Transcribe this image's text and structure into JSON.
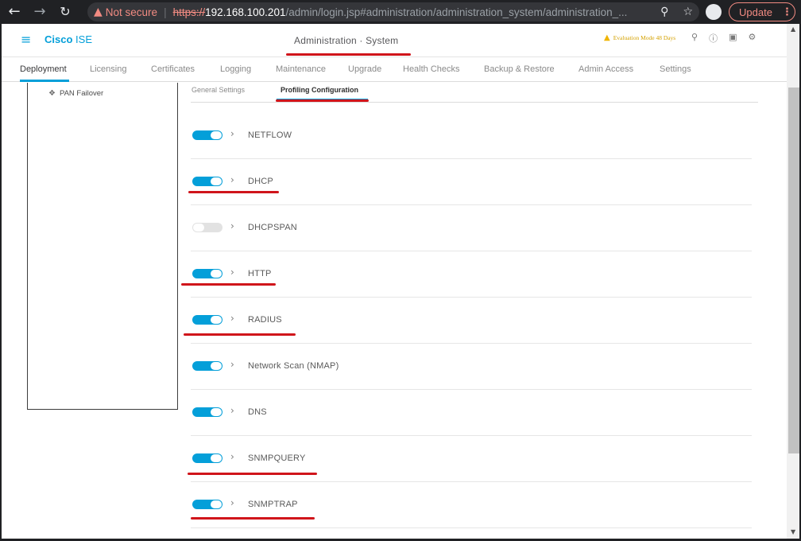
{
  "browser": {
    "not_secure": "Not secure",
    "url_scheme": "https://",
    "url_host": "192.168.100.201",
    "url_path": "/admin/login.jsp#administration/administration_system/administration_...",
    "update_label": "Update"
  },
  "header": {
    "brand_cisco": "Cisco",
    "brand_product": "ISE",
    "page_title": "Administration · System",
    "evaluation": "Evaluation Mode 48 Days"
  },
  "tabs": [
    "Deployment",
    "Licensing",
    "Certificates",
    "Logging",
    "Maintenance",
    "Upgrade",
    "Health Checks",
    "Backup & Restore",
    "Admin Access",
    "Settings"
  ],
  "tree": {
    "item": "PAN Failover"
  },
  "subtabs": {
    "general": "General Settings",
    "profiling": "Profiling Configuration"
  },
  "probes": [
    {
      "label": "NETFLOW",
      "enabled": true
    },
    {
      "label": "DHCP",
      "enabled": true
    },
    {
      "label": "DHCPSPAN",
      "enabled": false
    },
    {
      "label": "HTTP",
      "enabled": true
    },
    {
      "label": "RADIUS",
      "enabled": true
    },
    {
      "label": "Network Scan (NMAP)",
      "enabled": true
    },
    {
      "label": "DNS",
      "enabled": true
    },
    {
      "label": "SNMPQUERY",
      "enabled": true
    },
    {
      "label": "SNMPTRAP",
      "enabled": true
    }
  ],
  "colors": {
    "accent": "#049fd9",
    "annotation": "#d0151b",
    "warning": "#f0b400"
  }
}
